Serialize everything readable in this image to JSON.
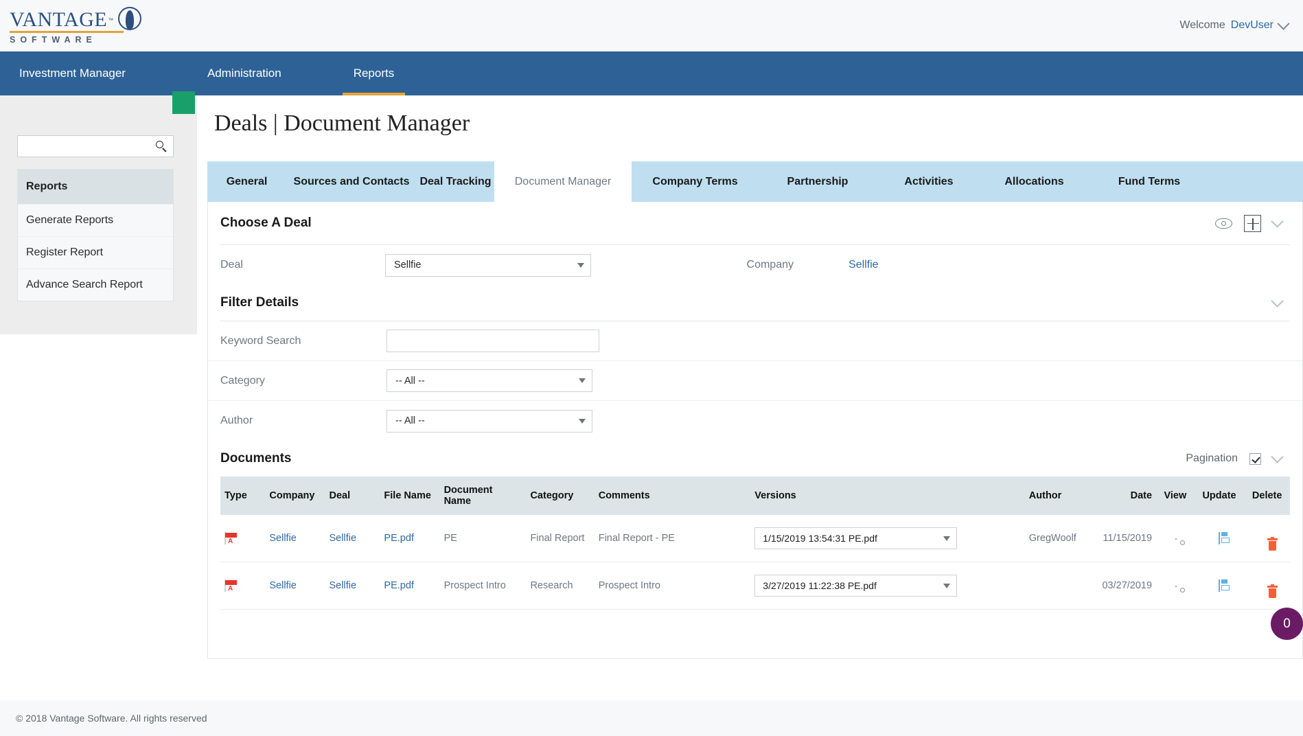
{
  "header": {
    "logo": {
      "name": "VANTAGE",
      "tm": "™",
      "subtitle": "SOFTWARE"
    },
    "welcome_label": "Welcome",
    "user": "DevUser"
  },
  "nav": {
    "items": [
      {
        "label": "Investment Manager",
        "active": false
      },
      {
        "label": "Administration",
        "active": false
      },
      {
        "label": "Reports",
        "active": true
      }
    ]
  },
  "sidebar": {
    "search_placeholder": "",
    "search_value": "",
    "menu_header": "Reports",
    "items": [
      {
        "label": "Generate Reports"
      },
      {
        "label": "Register Report"
      },
      {
        "label": "Advance Search Report"
      }
    ]
  },
  "main": {
    "page_title": "Deals | Document Manager",
    "tabs": [
      {
        "label": "General",
        "active": false
      },
      {
        "label": "Sources and Contacts",
        "active": false
      },
      {
        "label": "Deal Tracking",
        "active": false
      },
      {
        "label": "Document Manager",
        "active": true
      },
      {
        "label": "Company Terms",
        "active": false
      },
      {
        "label": "Partnership",
        "active": false
      },
      {
        "label": "Activities",
        "active": false
      },
      {
        "label": "Allocations",
        "active": false
      },
      {
        "label": "Fund Terms",
        "active": false
      }
    ],
    "choose_deal": {
      "title": "Choose A Deal",
      "deal_label": "Deal",
      "deal_value": "Sellfie",
      "company_label": "Company",
      "company_value": "Sellfie"
    },
    "filter_details": {
      "title": "Filter Details",
      "keyword_label": "Keyword Search",
      "keyword_value": "",
      "keyword_placeholder": "",
      "category_label": "Category",
      "category_value": "-- All --",
      "author_label": "Author",
      "author_value": "-- All --"
    },
    "documents": {
      "title": "Documents",
      "pagination_label": "Pagination",
      "pagination_checked": true,
      "columns": [
        "Type",
        "Company",
        "Deal",
        "File Name",
        "Document Name",
        "Category",
        "Comments",
        "Versions",
        "Author",
        "Date",
        "View",
        "Update",
        "Delete"
      ],
      "rows": [
        {
          "type": "pdf-icon",
          "company": "Sellfie",
          "deal": "Sellfie",
          "file_name": "PE.pdf",
          "document_name": "PE",
          "category": "Final Report",
          "comments": "Final Report - PE",
          "version": "1/15/2019 13:54:31 PE.pdf",
          "author": "GregWoolf",
          "date": "11/15/2019"
        },
        {
          "type": "pdf-icon",
          "company": "Sellfie",
          "deal": "Sellfie",
          "file_name": "PE.pdf",
          "document_name": "Prospect Intro",
          "category": "Research",
          "comments": "Prospect Intro",
          "version": "3/27/2019 11:22:38 PE.pdf",
          "author": "",
          "date": "03/27/2019"
        }
      ]
    },
    "badge_count": "0"
  },
  "footer": {
    "copyright": "© 2018 Vantage Software. All rights reserved"
  },
  "colors": {
    "nav_blue": "#2e6296",
    "tab_blue": "#bfdff1",
    "accent_orange": "#e8a33d",
    "link_blue": "#2c6aa8",
    "green_square": "#19a06a",
    "badge_purple": "#6b1b63",
    "table_header": "#dce4e7"
  }
}
